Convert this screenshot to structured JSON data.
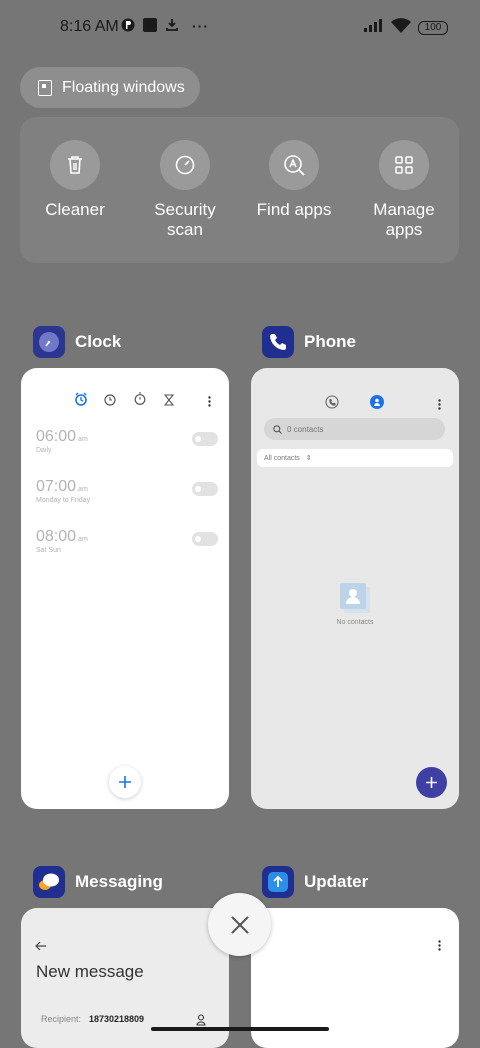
{
  "status_bar": {
    "time": "8:16 AM",
    "battery": "100"
  },
  "floating_windows": {
    "label": "Floating windows"
  },
  "quick_actions": [
    {
      "label": "Cleaner",
      "icon": "trash-icon"
    },
    {
      "label": "Security scan",
      "icon": "security-scan-icon"
    },
    {
      "label": "Find apps",
      "icon": "find-apps-icon"
    },
    {
      "label": "Manage apps",
      "icon": "grid-icon"
    }
  ],
  "apps": {
    "clock": {
      "name": "Clock",
      "alarms": [
        {
          "time": "06:00",
          "ampm": "am",
          "repeat": "Daily"
        },
        {
          "time": "07:00",
          "ampm": "am",
          "repeat": "Monday to Friday"
        },
        {
          "time": "08:00",
          "ampm": "am",
          "repeat": "Sat Sun"
        }
      ]
    },
    "phone": {
      "name": "Phone",
      "search_placeholder": "0 contacts",
      "filter": "All contacts",
      "empty_text": "No contacts"
    },
    "messaging": {
      "name": "Messaging",
      "title": "New message",
      "recipient_label": "Recipient:",
      "recipient_value": "18730218809"
    },
    "updater": {
      "name": "Updater"
    }
  },
  "colors": {
    "background": "#767676",
    "accent_blue": "#1a73e8",
    "phone_fab": "#3f3fa6"
  }
}
